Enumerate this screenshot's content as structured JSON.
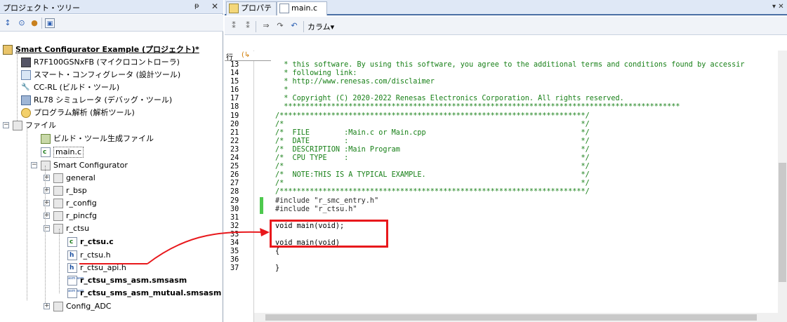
{
  "left_panel": {
    "title": "プロジェクト・ツリー",
    "pin": "ᵽ",
    "close": "✕",
    "tree": [
      {
        "label": "Smart Configurator Example (プロジェクト)*",
        "bold": true,
        "underline": true
      },
      {
        "label": "R7F100GSNxFB (マイクロコントローラ)"
      },
      {
        "label": "スマート・コンフィグレータ (設計ツール)"
      },
      {
        "label": "CC-RL (ビルド・ツール)"
      },
      {
        "label": "RL78 シミュレータ (デバッグ・ツール)"
      },
      {
        "label": "プログラム解析 (解析ツール)"
      },
      {
        "label": "ファイル"
      },
      {
        "label": "ビルド・ツール生成ファイル"
      },
      {
        "label": "main.c"
      },
      {
        "label": "Smart Configurator"
      },
      {
        "label": "general"
      },
      {
        "label": "r_bsp"
      },
      {
        "label": "r_config"
      },
      {
        "label": "r_pincfg"
      },
      {
        "label": "r_ctsu"
      },
      {
        "label": "r_ctsu.c",
        "bold": true
      },
      {
        "label": "r_ctsu.h"
      },
      {
        "label": "r_ctsu_api.h"
      },
      {
        "label": "r_ctsu_sms_asm.smsasm",
        "bold": true
      },
      {
        "label": "r_ctsu_sms_asm_mutual.smsasm",
        "bold": true
      },
      {
        "label": "Config_ADC"
      }
    ]
  },
  "right_panel": {
    "tabs": [
      {
        "label": "プロパティ"
      },
      {
        "label": "main.c"
      }
    ],
    "toolbar_column_label": "カラム▾",
    "header": {
      "col1": "行",
      "col2": "(↳"
    },
    "lines": [
      {
        "n": "13",
        "text": "  * this software. By using this software, you agree to the additional terms and conditions found by accessir",
        "cls": "cmt"
      },
      {
        "n": "14",
        "text": "  * following link:",
        "cls": "cmt"
      },
      {
        "n": "15",
        "text": "  * http://www.renesas.com/disclaimer",
        "cls": "cmt"
      },
      {
        "n": "16",
        "text": "  *",
        "cls": "cmt"
      },
      {
        "n": "17",
        "text": "  * Copyright (C) 2020-2022 Renesas Electronics Corporation. All rights reserved.",
        "cls": "cmt"
      },
      {
        "n": "18",
        "text": "  ********************************************************************************************",
        "cls": "cmt"
      },
      {
        "n": "19",
        "text": "/***********************************************************************/",
        "cls": "cmt"
      },
      {
        "n": "20",
        "text": "/*                                                                     */",
        "cls": "cmt"
      },
      {
        "n": "21",
        "text": "/*  FILE        :Main.c or Main.cpp                                    */",
        "cls": "cmt"
      },
      {
        "n": "22",
        "text": "/*  DATE        :                                                      */",
        "cls": "cmt"
      },
      {
        "n": "23",
        "text": "/*  DESCRIPTION :Main Program                                          */",
        "cls": "cmt"
      },
      {
        "n": "24",
        "text": "/*  CPU TYPE    :                                                      */",
        "cls": "cmt"
      },
      {
        "n": "25",
        "text": "/*                                                                     */",
        "cls": "cmt"
      },
      {
        "n": "26",
        "text": "/*  NOTE:THIS IS A TYPICAL EXAMPLE.                                    */",
        "cls": "cmt"
      },
      {
        "n": "27",
        "text": "/*                                                                     */",
        "cls": "cmt"
      },
      {
        "n": "28",
        "text": "/***********************************************************************/",
        "cls": "cmt"
      },
      {
        "n": "29",
        "text": "#include \"r_smc_entry.h\"",
        "cls": "pp",
        "green": true
      },
      {
        "n": "30",
        "text": "#include \"r_ctsu.h\"",
        "cls": "pp",
        "green": true
      },
      {
        "n": "31",
        "text": "",
        "cls": ""
      },
      {
        "n": "32",
        "text": "void main(void);",
        "cls": ""
      },
      {
        "n": "33",
        "text": "",
        "cls": ""
      },
      {
        "n": "34",
        "text": "void main(void)",
        "cls": ""
      },
      {
        "n": "35",
        "text": "{",
        "cls": ""
      },
      {
        "n": "36",
        "text": "",
        "cls": ""
      },
      {
        "n": "37",
        "text": "}",
        "cls": ""
      }
    ]
  },
  "colors": {
    "annotation": "#e8181c",
    "comment": "#188018",
    "modified_marker": "#4ec94e"
  }
}
